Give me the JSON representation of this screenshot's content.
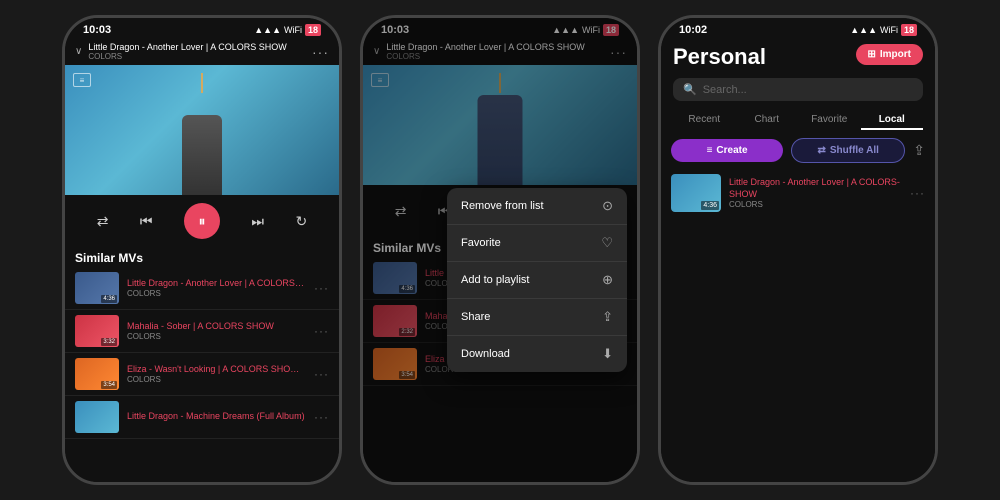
{
  "phone1": {
    "status_time": "10:03",
    "now_playing_title": "Little Dragon - Another Lover | A COLORS SHOW",
    "now_playing_subtitle": "COLORS",
    "similar_mvs_label": "Similar MVs",
    "list_items": [
      {
        "title": "Little Dragon - Another Lover | A COLORS SHOW",
        "sub": "COLORS",
        "duration": "4:36",
        "thumb_class": "thumb-1"
      },
      {
        "title": "Mahalia - Sober | A COLORS SHOW",
        "sub": "COLORS",
        "duration": "3:32",
        "thumb_class": "thumb-2"
      },
      {
        "title": "Eliza - Wasn't Looking | A COLORS SHOW (Full Album)",
        "sub": "COLORS",
        "duration": "3:54",
        "thumb_class": "thumb-3"
      },
      {
        "title": "Little Dragon - Machine Dreams (Full Album)",
        "sub": "",
        "duration": "",
        "thumb_class": "thumb-4"
      }
    ]
  },
  "phone2": {
    "status_time": "10:03",
    "now_playing_title": "Little Dragon - Another Lover | A COLORS SHOW",
    "now_playing_subtitle": "COLORS",
    "similar_mvs_label": "Similar MVs",
    "context_menu": {
      "items": [
        {
          "label": "Remove from list",
          "icon": "⊙"
        },
        {
          "label": "Favorite",
          "icon": "♡"
        },
        {
          "label": "Add to playlist",
          "icon": "⊕"
        },
        {
          "label": "Share",
          "icon": "⇪"
        },
        {
          "label": "Download",
          "icon": "⬇"
        }
      ]
    },
    "list_items": [
      {
        "title": "Little Dragon - Another Lover | A COLORS SHOW",
        "sub": "COLORS",
        "duration": "4:36",
        "thumb_class": "thumb-1"
      },
      {
        "title": "Mahalia - Sober | A COLORS SHOW",
        "sub": "COLORS",
        "duration": "2:32",
        "thumb_class": "thumb-2"
      },
      {
        "title": "Eliza - Wasn't Looking | A COLORS SHOW",
        "sub": "COLORS",
        "duration": "3:54",
        "thumb_class": "thumb-3"
      }
    ]
  },
  "phone3": {
    "status_time": "10:02",
    "import_label": "Import",
    "library_title": "Personal",
    "search_placeholder": "Search...",
    "tabs": [
      {
        "label": "Recent",
        "active": false
      },
      {
        "label": "Chart",
        "active": false
      },
      {
        "label": "Favorite",
        "active": false
      },
      {
        "label": "Local",
        "active": true
      }
    ],
    "create_label": "Create",
    "shuffle_label": "Shuffle All",
    "list_items": [
      {
        "title": "Little Dragon - Another Lover | A COLORS-SHOW",
        "sub": "COLORS",
        "duration": "4:36"
      }
    ]
  }
}
